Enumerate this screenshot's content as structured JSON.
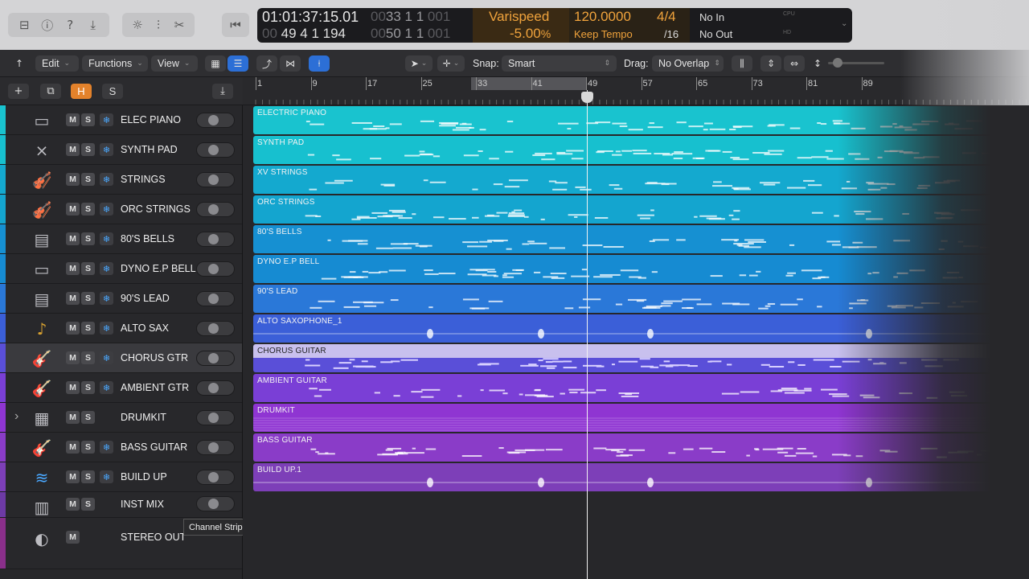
{
  "control_bar": {
    "left_icons": [
      "library-icon",
      "info-icon",
      "help-icon",
      "download-icon"
    ],
    "mid_icons": [
      "brightness-icon",
      "mixer-icon",
      "scissors-icon"
    ],
    "back_icon": "rewind-to-start-icon",
    "lcd": {
      "time": "01:01:37:15.01",
      "time_sub": "49  4  1  194",
      "bars_dim": "00",
      "bars": "33  1  1",
      "bars_dim2": "001",
      "bars_sub_dim": "00",
      "bars_sub": "50  1  1",
      "bars_sub_dim2": "001",
      "varispeed_label": "Varispeed",
      "varispeed_value": "-5.00",
      "varispeed_unit": "%",
      "tempo": "120.0000",
      "tempo_mode": "Keep Tempo",
      "signature": "4/4",
      "division": "/16",
      "in": "No In",
      "out": "No Out",
      "cpu_label": "CPU",
      "hd_label": "HD",
      "accent": "#f0a33c"
    }
  },
  "toolbar": {
    "up_icon": "up-arrow-icon",
    "edit": "Edit",
    "functions": "Functions",
    "view": "View",
    "snap_label": "Snap:",
    "snap_value": "Smart",
    "drag_label": "Drag:",
    "drag_value": "No Overlap",
    "icons": [
      "grid-view-icon",
      "list-view-icon",
      "automation-icon",
      "flex-icon",
      "catch-playhead-icon",
      "pointer-tool-icon",
      "crosshair-tool-icon",
      "waveform-zoom-icon",
      "vertical-zoom-icon",
      "horizontal-zoom-icon"
    ]
  },
  "track_header": {
    "add": "+",
    "duplicate_icon": "duplicate-track-icon",
    "hide": "H",
    "solo": "S",
    "import_icon": "import-icon"
  },
  "ruler": {
    "bars": [
      "1",
      "9",
      "17",
      "25",
      "33",
      "41",
      "49",
      "57",
      "65",
      "73",
      "81",
      "89"
    ]
  },
  "tracks": [
    {
      "name": "ELEC PIANO",
      "region": "ELECTRIC PIANO",
      "color": "#19c3cf",
      "icon": "electric-piano-icon",
      "freeze": true,
      "solo": true
    },
    {
      "name": "SYNTH PAD",
      "region": "SYNTH PAD",
      "color": "#17c0cf",
      "icon": "keyboard-stand-icon",
      "freeze": true,
      "solo": true
    },
    {
      "name": "STRINGS",
      "region": "XV STRINGS",
      "color": "#14a9cf",
      "icon": "violin-icon",
      "freeze": true,
      "solo": true
    },
    {
      "name": "ORC STRINGS",
      "region": "ORC STRINGS",
      "color": "#14a5cf",
      "icon": "violin-icon",
      "freeze": true,
      "solo": true
    },
    {
      "name": "80'S BELLS",
      "region": "80'S BELLS",
      "color": "#1690d2",
      "icon": "synth-stand-icon",
      "freeze": true,
      "solo": true
    },
    {
      "name": "DYNO E.P BELL",
      "region": "DYNO E.P BELL",
      "color": "#168bd2",
      "icon": "electric-piano-icon",
      "freeze": true,
      "solo": true
    },
    {
      "name": "90'S LEAD",
      "region": "90'S LEAD",
      "color": "#2a78d8",
      "icon": "synth-stand-icon",
      "freeze": true,
      "solo": true
    },
    {
      "name": "ALTO SAX",
      "region": "ALTO SAXOPHONE_1",
      "color": "#3b5fd8",
      "icon": "saxophone-icon",
      "freeze": true,
      "solo": true
    },
    {
      "name": "CHORUS GTR",
      "region": "CHORUS GUITAR",
      "color": "#5a4fd8",
      "icon": "electric-guitar-icon",
      "freeze": true,
      "solo": true,
      "selected": true
    },
    {
      "name": "AMBIENT GTR",
      "region": "AMBIENT GUITAR",
      "color": "#7a3fd6",
      "icon": "electric-guitar-icon",
      "freeze": true,
      "solo": true
    },
    {
      "name": "DRUMKIT",
      "region": "DRUMKIT",
      "color": "#8f35d2",
      "icon": "drum-machine-icon",
      "freeze": false,
      "solo": true,
      "disclosure": true
    },
    {
      "name": "BASS GUITAR",
      "region": "BASS GUITAR",
      "color": "#8a3cc8",
      "icon": "bass-guitar-icon",
      "freeze": true,
      "solo": true
    },
    {
      "name": "BUILD UP",
      "region": "BUILD UP.1",
      "color": "#7d3fb8",
      "icon": "waveform-icon",
      "freeze": true,
      "solo": true
    },
    {
      "name": "INST MIX",
      "color": "#6d3aa5",
      "icon": "mixer-device-icon",
      "freeze": false,
      "solo": true
    },
    {
      "name": "STEREO OUT",
      "color": "#8a2f8a",
      "icon": "speaker-icon",
      "freeze": false,
      "solo": false,
      "tall": true
    }
  ],
  "tooltip": "Channel Strip Name",
  "labels": {
    "mute": "M",
    "solo": "S"
  }
}
